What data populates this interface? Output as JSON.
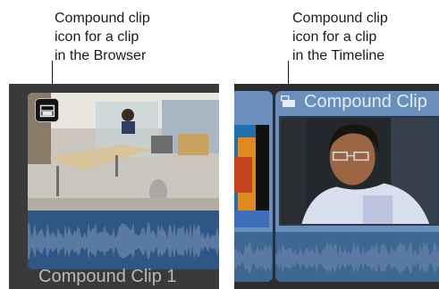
{
  "callouts": {
    "browser": "Compound clip\nicon for a clip\nin the Browser",
    "timeline": "Compound clip\nicon for a clip\nin the Timeline"
  },
  "browser": {
    "clip_name": "Compound Clip 1",
    "compound_icon": "compound-clip-icon"
  },
  "timeline": {
    "clip_name": "Compound Clip",
    "compound_icon": "compound-clip-icon"
  },
  "colors": {
    "clip_blue": "#6b8fbd",
    "waveform": "#5a7aa3",
    "panel_dark": "#3a3a3a",
    "name_text": "#b9b9b9"
  }
}
